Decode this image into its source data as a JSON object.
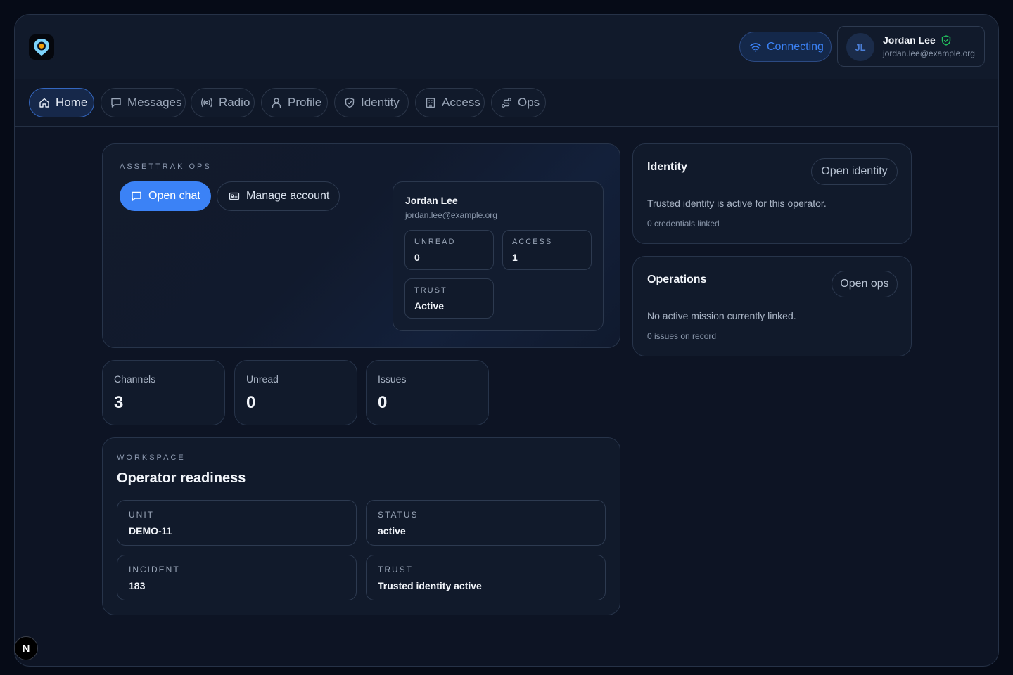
{
  "header": {
    "connection_status": "Connecting",
    "user": {
      "initials": "JL",
      "name": "Jordan Lee",
      "email": "jordan.lee@example.org"
    }
  },
  "nav": {
    "tabs": [
      {
        "label": "Home",
        "icon": "home-icon",
        "active": true
      },
      {
        "label": "Messages",
        "icon": "message-icon",
        "active": false
      },
      {
        "label": "Radio",
        "icon": "radio-icon",
        "active": false
      },
      {
        "label": "Profile",
        "icon": "user-icon",
        "active": false
      },
      {
        "label": "Identity",
        "icon": "shield-icon",
        "active": false
      },
      {
        "label": "Access",
        "icon": "building-icon",
        "active": false
      },
      {
        "label": "Ops",
        "icon": "route-icon",
        "active": false
      }
    ]
  },
  "hero": {
    "eyebrow": "ASSETTRAK OPS",
    "open_chat_label": "Open chat",
    "manage_account_label": "Manage account",
    "profile": {
      "name": "Jordan Lee",
      "email": "jordan.lee@example.org",
      "stats": [
        {
          "label": "UNREAD",
          "value": "0"
        },
        {
          "label": "ACCESS",
          "value": "1"
        },
        {
          "label": "TRUST",
          "value": "Active"
        }
      ]
    }
  },
  "kpis": [
    {
      "label": "Channels",
      "value": "3"
    },
    {
      "label": "Unread",
      "value": "0"
    },
    {
      "label": "Issues",
      "value": "0"
    }
  ],
  "workspace": {
    "eyebrow": "WORKSPACE",
    "title": "Operator readiness",
    "fields": [
      {
        "label": "UNIT",
        "value": "DEMO-11"
      },
      {
        "label": "STATUS",
        "value": "active"
      },
      {
        "label": "INCIDENT",
        "value": "183"
      },
      {
        "label": "TRUST",
        "value": "Trusted identity active"
      }
    ]
  },
  "identity_card": {
    "title": "Identity",
    "button_label": "Open identity",
    "text": "Trusted identity is active for this operator.",
    "sub": "0 credentials linked"
  },
  "operations_card": {
    "title": "Operations",
    "button_label": "Open ops",
    "text": "No active mission currently linked.",
    "sub": "0 issues on record"
  },
  "dev_badge": "N",
  "colors": {
    "accent": "#3b82f6",
    "background": "#0d1424",
    "card": "#111a2b",
    "verified": "#22c55e"
  }
}
